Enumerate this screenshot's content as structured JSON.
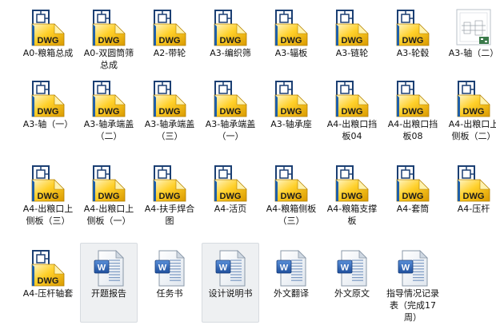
{
  "files": [
    {
      "name": "A0-粮箱总成",
      "type": "dwg"
    },
    {
      "name": "A0-双圆筒筛总成",
      "type": "dwg"
    },
    {
      "name": "A2-带轮",
      "type": "dwg"
    },
    {
      "name": "A3-编织筛",
      "type": "dwg"
    },
    {
      "name": "A3-辐板",
      "type": "dwg"
    },
    {
      "name": "A3-链轮",
      "type": "dwg"
    },
    {
      "name": "A3-轮毂",
      "type": "dwg"
    },
    {
      "name": "A3-轴（二）",
      "type": "dwg-preview"
    },
    {
      "name": "A3-轴（一）",
      "type": "dwg"
    },
    {
      "name": "A3-轴承端盖（二）",
      "type": "dwg"
    },
    {
      "name": "A3-轴承端盖（三）",
      "type": "dwg"
    },
    {
      "name": "A3-轴承端盖（一）",
      "type": "dwg"
    },
    {
      "name": "A3-轴承座",
      "type": "dwg"
    },
    {
      "name": "A4-出粮口挡板04",
      "type": "dwg"
    },
    {
      "name": "A4-出粮口挡板08",
      "type": "dwg"
    },
    {
      "name": "A4-出粮口上侧板（二）",
      "type": "dwg"
    },
    {
      "name": "A4-出粮口上侧板（三）",
      "type": "dwg"
    },
    {
      "name": "A4-出粮口上侧板（一）",
      "type": "dwg"
    },
    {
      "name": "A4-扶手焊合图",
      "type": "dwg"
    },
    {
      "name": "A4-活页",
      "type": "dwg"
    },
    {
      "name": "A4-粮箱侧板（三）",
      "type": "dwg"
    },
    {
      "name": "A4-粮箱支撑板",
      "type": "dwg"
    },
    {
      "name": "A4-套筒",
      "type": "dwg"
    },
    {
      "name": "A4-压杆",
      "type": "dwg"
    },
    {
      "name": "A4-压杆轴套",
      "type": "dwg"
    },
    {
      "name": "开题报告",
      "type": "doc",
      "highlighted": true
    },
    {
      "name": "任务书",
      "type": "doc"
    },
    {
      "name": "设计说明书",
      "type": "doc",
      "highlighted": true
    },
    {
      "name": "外文翻译",
      "type": "doc"
    },
    {
      "name": "外文原文",
      "type": "doc"
    },
    {
      "name": "指导情况记录表（完成17周）",
      "type": "doc"
    }
  ],
  "icon_text": {
    "dwg": "DWG",
    "doc": "W"
  },
  "colors": {
    "dwg_gold": "#f0b400",
    "dwg_blue": "#1f5fa8",
    "doc_blue": "#2a63b8"
  }
}
